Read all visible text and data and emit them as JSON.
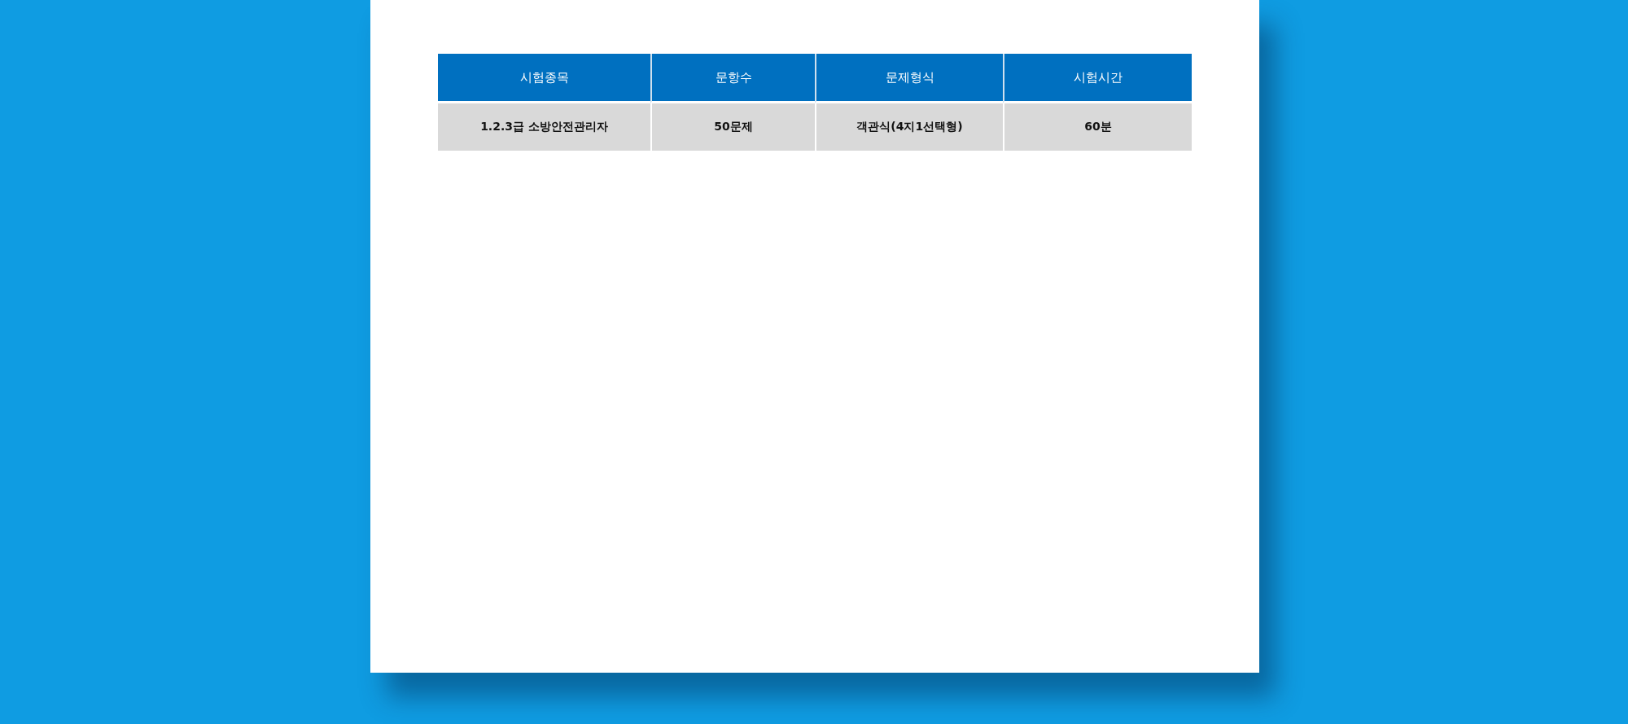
{
  "table": {
    "columns": [
      "시험종목",
      "문항수",
      "문제형식",
      "시험시간"
    ],
    "rows": [
      [
        "1.2.3급 소방안전관리자",
        "50문제",
        "객관식(4지1선택형)",
        "60분"
      ]
    ]
  }
}
